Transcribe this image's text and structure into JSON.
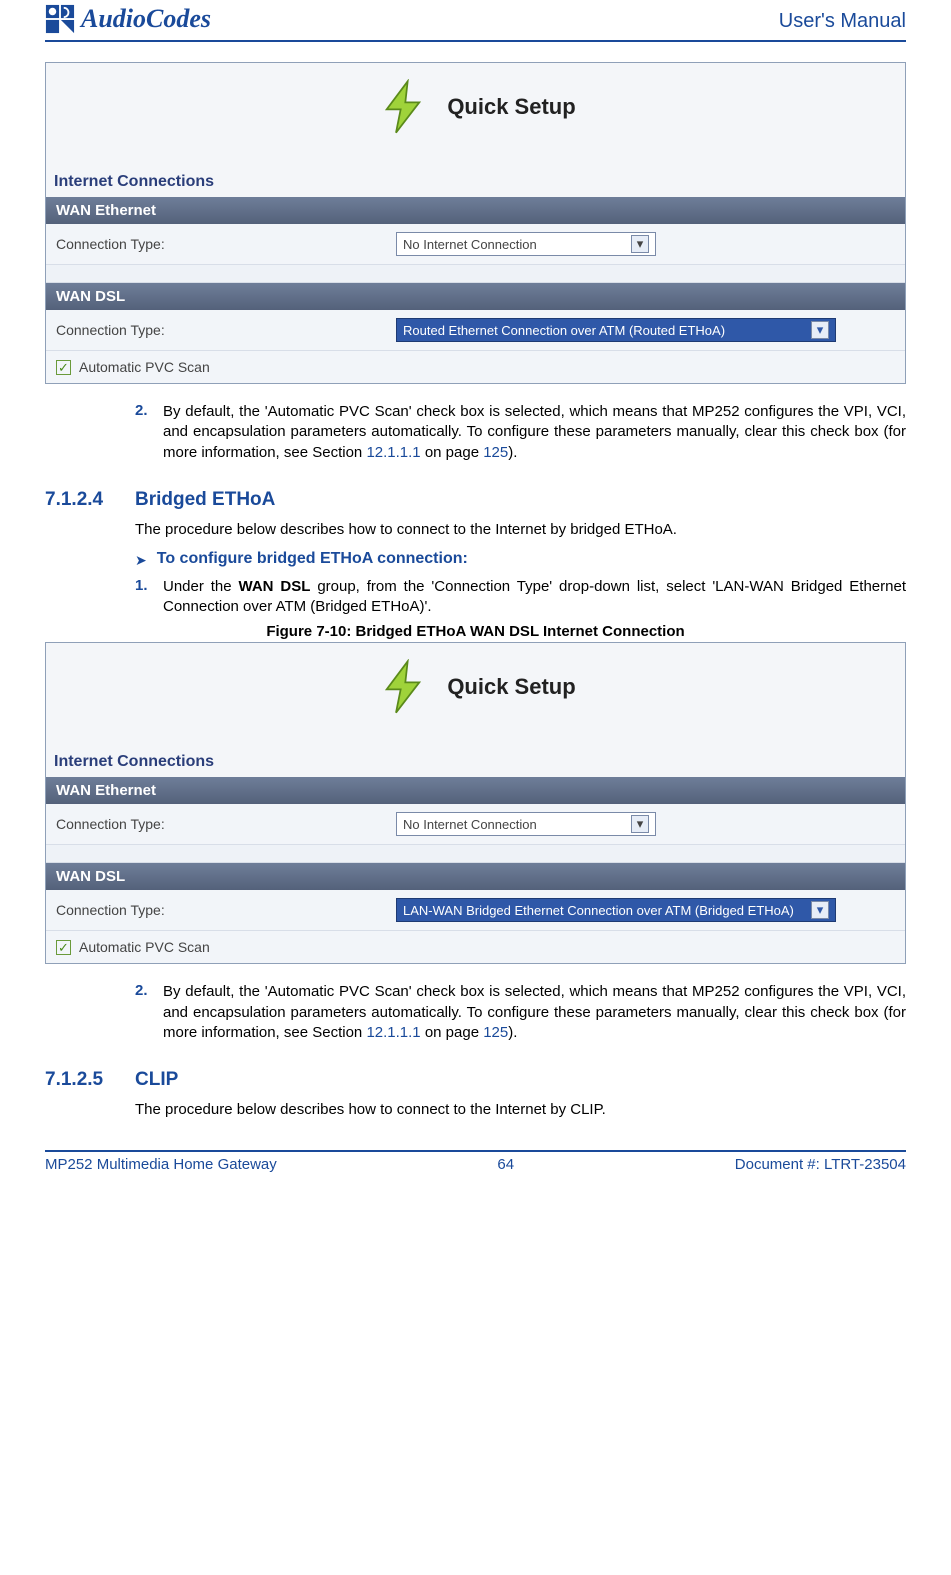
{
  "header": {
    "logo_text": "AudioCodes",
    "title": "User's Manual"
  },
  "qs1": {
    "title": "Quick Setup",
    "section_label": "Internet Connections",
    "wan_eth_bar": "WAN Ethernet",
    "conn_type_label": "Connection Type:",
    "wan_eth_value": "No Internet Connection",
    "wan_dsl_bar": "WAN DSL",
    "wan_dsl_value": "Routed Ethernet Connection over ATM (Routed ETHoA)",
    "pvc_label": "Automatic PVC Scan"
  },
  "step2a": {
    "num": "2.",
    "text_pre": "By default, the 'Automatic PVC Scan' check box is selected, which means that MP252 configures the VPI, VCI, and encapsulation parameters automatically. To configure these parameters manually, clear this check box (for more information, see Section ",
    "ref1": "12.1.1.1",
    "mid": " on page ",
    "ref2": "125",
    "post": ")."
  },
  "sec_bridged": {
    "num": "7.1.2.4",
    "title": "Bridged ETHoA",
    "intro": "The procedure below describes how to connect to the Internet by bridged ETHoA.",
    "proc_title": "To configure bridged ETHoA connection:",
    "step1_num": "1.",
    "step1_pre": "Under the ",
    "step1_bold": "WAN DSL",
    "step1_post": " group, from the 'Connection Type' drop-down list, select 'LAN-WAN Bridged Ethernet Connection over ATM (Bridged ETHoA)'.",
    "fig_caption": "Figure 7-10: Bridged ETHoA WAN DSL Internet Connection"
  },
  "qs2": {
    "title": "Quick Setup",
    "section_label": "Internet Connections",
    "wan_eth_bar": "WAN Ethernet",
    "conn_type_label": "Connection Type:",
    "wan_eth_value": "No Internet Connection",
    "wan_dsl_bar": "WAN DSL",
    "wan_dsl_value": "LAN-WAN Bridged Ethernet Connection over ATM (Bridged ETHoA)",
    "pvc_label": "Automatic PVC Scan"
  },
  "step2b": {
    "num": "2.",
    "text_pre": "By default, the 'Automatic PVC Scan' check box is selected, which means that MP252 configures the VPI, VCI, and encapsulation parameters automatically. To configure these parameters manually, clear this check box (for more information, see Section ",
    "ref1": "12.1.1.1",
    "mid": " on page ",
    "ref2": "125",
    "post": ")."
  },
  "sec_clip": {
    "num": "7.1.2.5",
    "title": "CLIP",
    "intro": "The procedure below describes how to connect to the Internet by CLIP."
  },
  "footer": {
    "left": "MP252 Multimedia Home Gateway",
    "center": "64",
    "right": "Document #: LTRT-23504"
  }
}
